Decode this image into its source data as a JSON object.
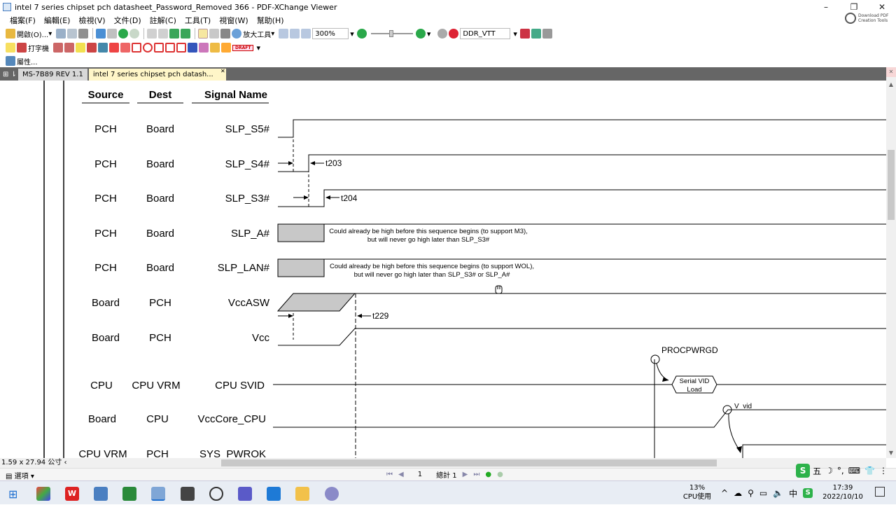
{
  "window": {
    "title": "intel 7 series chipset pch datasheet_Password_Removed 366 - PDF-XChange Viewer",
    "controls": {
      "minimize": "–",
      "restore": "❐",
      "close": "✕"
    }
  },
  "menu": [
    "檔案(F)",
    "編輯(E)",
    "檢視(V)",
    "文件(D)",
    "註解(C)",
    "工具(T)",
    "視窗(W)",
    "幫助(H)"
  ],
  "pdf_tools": {
    "label": "Download PDF Creation Tools"
  },
  "toolbar1": {
    "open_label": "開啟(O)...",
    "zoom_tool_label": "放大工具",
    "zoom_value": "300%",
    "search_value": "DDR_VTT"
  },
  "toolbar2": {
    "typewriter_label": "打字機",
    "stamp_label": "DRAFT"
  },
  "toolbar3": {
    "properties_label": "屬性..."
  },
  "tabs": [
    {
      "label": "MS-7B89 REV 1.1",
      "active": false
    },
    {
      "label": "intel 7 series chipset pch datash...",
      "active": true
    }
  ],
  "diagram": {
    "headers": {
      "source": "Source",
      "dest": "Dest",
      "signal": "Signal Name"
    },
    "rows": [
      {
        "source": "PCH",
        "dest": "Board",
        "signal": "SLP_S5#"
      },
      {
        "source": "PCH",
        "dest": "Board",
        "signal": "SLP_S4#"
      },
      {
        "source": "PCH",
        "dest": "Board",
        "signal": "SLP_S3#"
      },
      {
        "source": "PCH",
        "dest": "Board",
        "signal": "SLP_A#"
      },
      {
        "source": "PCH",
        "dest": "Board",
        "signal": "SLP_LAN#"
      },
      {
        "source": "Board",
        "dest": "PCH",
        "signal": "VccASW"
      },
      {
        "source": "Board",
        "dest": "PCH",
        "signal": "Vcc"
      },
      {
        "source": "CPU",
        "dest": "CPU VRM",
        "signal": "CPU SVID"
      },
      {
        "source": "Board",
        "dest": "CPU",
        "signal": "VccCore_CPU"
      },
      {
        "source": "CPU VRM",
        "dest": "PCH",
        "signal": "SYS_PWROK"
      }
    ],
    "timing_labels": {
      "t203": "t203",
      "t204": "t204",
      "t229": "t229"
    },
    "notes": {
      "slp_a_1": "Could already be high before this sequence begins (to support M3),",
      "slp_a_2": "but will never go high later than SLP_S3#",
      "slp_lan_1": "Could already be high before this sequence begins (to support WOL),",
      "slp_lan_2": "but will never go high later than SLP_S3# or SLP_A#"
    },
    "procpwrgd": "PROCPWRGD",
    "serial_vid_1": "Serial VID",
    "serial_vid_2": "Load",
    "v_vid": "V_vid"
  },
  "page_size": "1.59 x 27.94 公寸",
  "status": {
    "options_label": "選項",
    "page_current": "1",
    "page_total": "總計 1"
  },
  "ime": {
    "mode": "五"
  },
  "taskbar": {
    "cpu_percent": "13%",
    "cpu_label": "CPU使用",
    "ime_char": "中",
    "time": "17:39",
    "date": "2022/10/10"
  }
}
